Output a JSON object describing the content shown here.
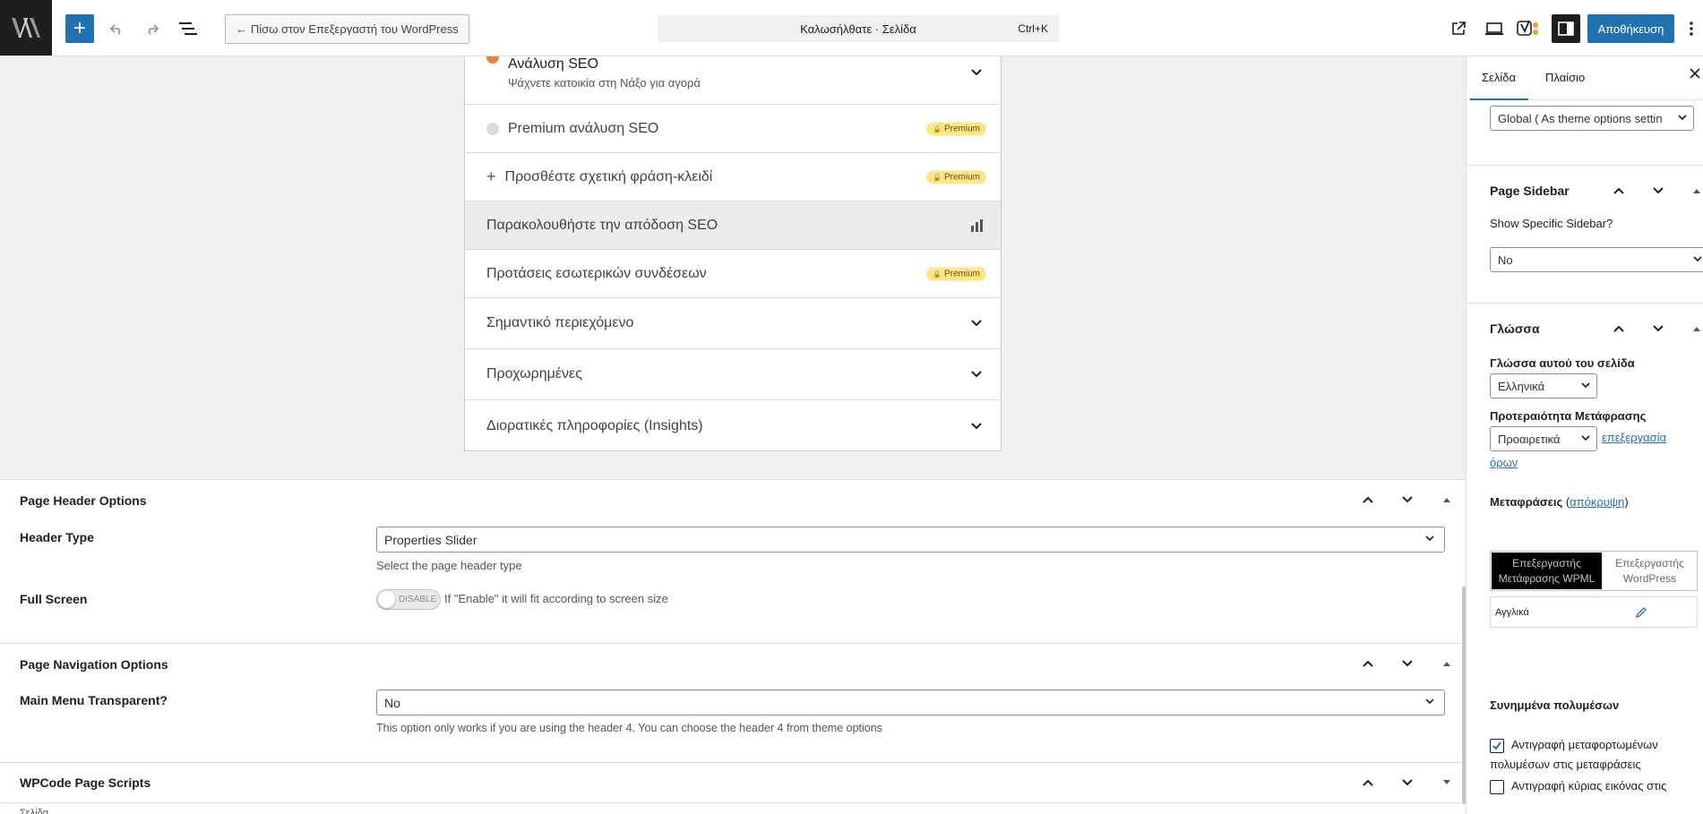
{
  "toolbar": {
    "back_label": "← Πίσω στον Επεξεργαστή του WordPress",
    "command_label": "Καλωσήλθατε · Σελίδα",
    "command_shortcut": "Ctrl+K",
    "save_label": "Αποθήκευση",
    "brand_color": "#2271b1"
  },
  "seo_panel": {
    "analysis_title": "Ανάλυση SEO",
    "analysis_subtitle": "Ψάχνετε κατοικία στη Νάξο για αγορά",
    "rows": [
      {
        "label": "Premium ανάλυση SEO",
        "badge": "Premium"
      },
      {
        "label": "Προσθέστε σχετική φράση-κλειδί",
        "badge": "Premium"
      },
      {
        "label": "Παρακολουθήστε την απόδοση SEO"
      },
      {
        "label": "Προτάσεις εσωτερικών συνδέσεων",
        "badge": "Premium"
      },
      {
        "label": "Σημαντικό περιεχόμενο"
      },
      {
        "label": "Προχωρημένες"
      },
      {
        "label": "Διορατικές πληροφορίες (Insights)"
      }
    ]
  },
  "meta_boxes": {
    "header": {
      "title": "Page Header Options",
      "header_type_label": "Header Type",
      "header_type_value": "Properties Slider",
      "header_type_hint": "Select the page header type",
      "full_screen_label": "Full Screen",
      "full_screen_toggle": "DISABLE",
      "full_screen_hint": "If \"Enable\" it will fit according to screen size"
    },
    "navigation": {
      "title": "Page Navigation Options",
      "menu_label": "Main Menu Transparent?",
      "menu_value": "No",
      "menu_hint": "This option only works if you are using the header 4. You can choose the header 4 from theme options"
    },
    "wpcode": {
      "title": "WPCode Page Scripts"
    },
    "footer_crumb": "Σελίδα"
  },
  "sidebar": {
    "tab_page": "Σελίδα",
    "tab_block": "Πλαίσιο",
    "global_select": "Global ( As theme options settin",
    "page_sidebar_title": "Page Sidebar",
    "specific_sidebar_label": "Show Specific Sidebar?",
    "specific_sidebar_value": "No",
    "language_title": "Γλώσσα",
    "page_language_label": "Γλώσσα αυτού του σελίδα",
    "page_language_value": "Ελληνικά",
    "priority_label": "Προτεραιότητα Μετάφρασης",
    "priority_value": "Προαιρετικά",
    "edit_terms_link_1": "επεξεργασία",
    "edit_terms_link_2": "όρων",
    "translations_label": "Μεταφράσεις",
    "hide_link": "απόκρυψη",
    "wpml_editor_line1": "Επεξεργαστής",
    "wpml_editor_line2": "Μετάφρασης WPML",
    "wp_editor_line1": "Επεξεργαστής",
    "wp_editor_line2": "WordPress",
    "translation_language": "Αγγλικά",
    "media_title": "Συνημμένα πολυμέσων",
    "media_option_1_line1": "Αντιγραφή μεταφορτωμένων",
    "media_option_1_line2": "πολυμέσων στις μεταφράσεις",
    "media_option_2_line1": "Αντιγραφή κύριας εικόνας στις"
  }
}
